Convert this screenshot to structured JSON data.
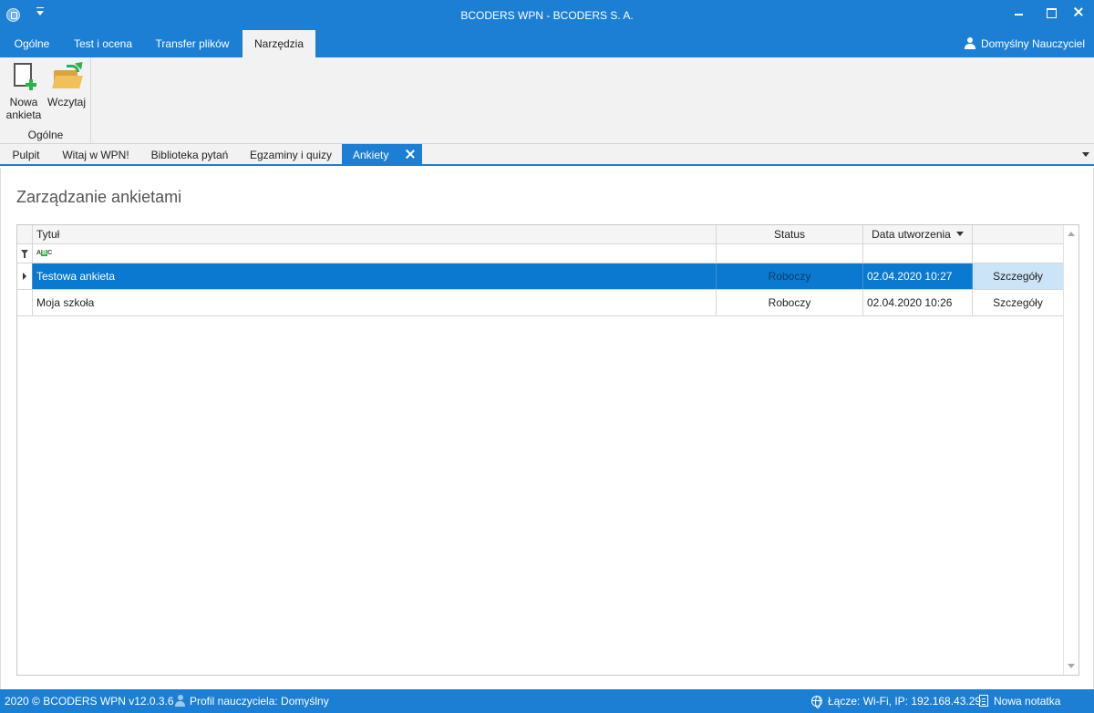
{
  "window": {
    "title": "BCODERS WPN - BCODERS S. A."
  },
  "ribbon_tabs": [
    {
      "label": "Ogólne"
    },
    {
      "label": "Test i ocena"
    },
    {
      "label": "Transfer plików"
    },
    {
      "label": "Narzędzia"
    }
  ],
  "ribbon_active_tab": "Narzędzia",
  "user": {
    "name": "Domyślny Nauczyciel"
  },
  "ribbon": {
    "new_survey_label_1": "Nowa",
    "new_survey_label_2": "ankieta",
    "load_label": "Wczytaj",
    "group_label": "Ogólne"
  },
  "doc_tabs": [
    {
      "label": "Pulpit"
    },
    {
      "label": "Witaj w WPN!"
    },
    {
      "label": "Biblioteka pytań"
    },
    {
      "label": "Egzaminy i quizy"
    },
    {
      "label": "Ankiety"
    }
  ],
  "doc_active_tab": "Ankiety",
  "page": {
    "title": "Zarządzanie ankietami"
  },
  "grid": {
    "columns": {
      "title": "Tytuł",
      "status": "Status",
      "created": "Data utworzenia"
    },
    "rows": [
      {
        "title": "Testowa ankieta",
        "status": "Roboczy",
        "created": "02.04.2020 10:27",
        "details": "Szczegóły",
        "selected": true
      },
      {
        "title": "Moja szkoła",
        "status": "Roboczy",
        "created": "02.04.2020 10:26",
        "details": "Szczegóły",
        "selected": false
      }
    ]
  },
  "statusbar": {
    "copyright": "2020 ©  BCODERS WPN v12.0.3.6",
    "profile": "Profil nauczyciela: Domyślny",
    "connection": "Łącze: Wi-Fi, IP: 192.168.43.29",
    "new_note": "Nowa notatka"
  },
  "colors": {
    "accent": "#1c7fd4",
    "selected_row": "#0a79cf",
    "ribbon_bg": "#f2f2f2"
  }
}
